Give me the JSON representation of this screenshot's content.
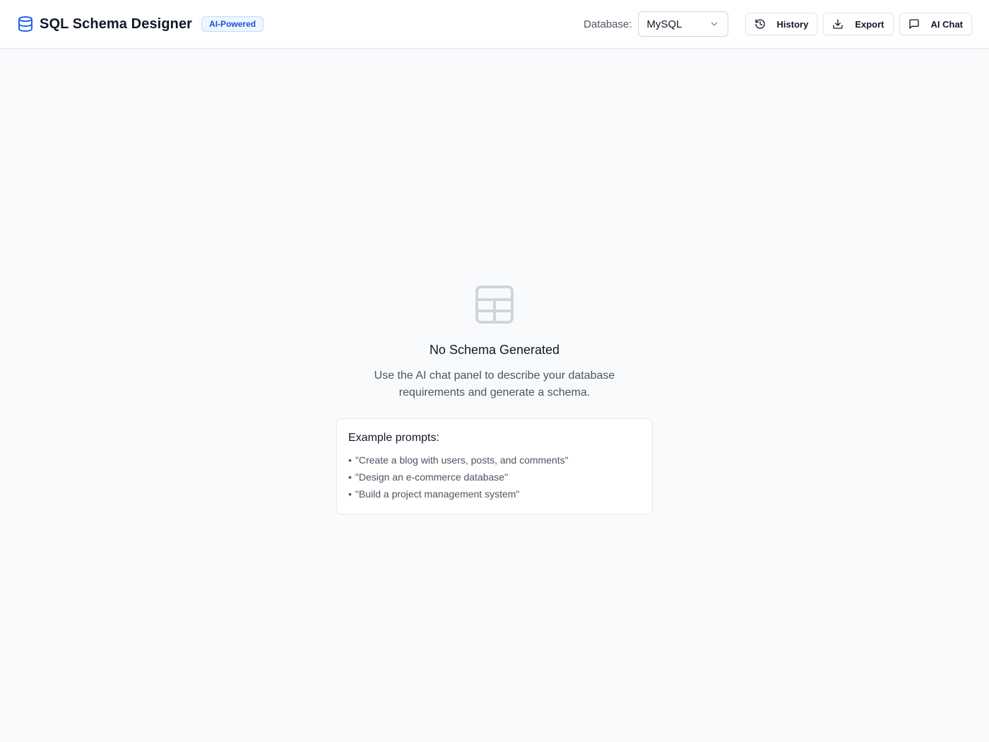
{
  "header": {
    "title": "SQL Schema Designer",
    "badge": "AI-Powered",
    "database_label": "Database:",
    "database_value": "MySQL",
    "buttons": {
      "history": "History",
      "export": "Export",
      "ai_chat": "AI Chat"
    }
  },
  "empty_state": {
    "title": "No Schema Generated",
    "description": "Use the AI chat panel to describe your database requirements and generate a schema.",
    "examples_title": "Example prompts:",
    "examples": [
      "\"Create a blog with users, posts, and comments\"",
      "\"Design an e-commerce database\"",
      "\"Build a project management system\""
    ]
  },
  "icons": {
    "brand": "database-icon",
    "history": "history-icon",
    "export": "download-icon",
    "ai_chat": "chat-icon",
    "dropdown": "chevron-down-icon",
    "empty": "table-icon"
  },
  "colors": {
    "accent": "#2563eb",
    "badge_bg": "#eff6ff",
    "badge_text": "#1d4ed8",
    "page_bg": "#f9fafb"
  }
}
